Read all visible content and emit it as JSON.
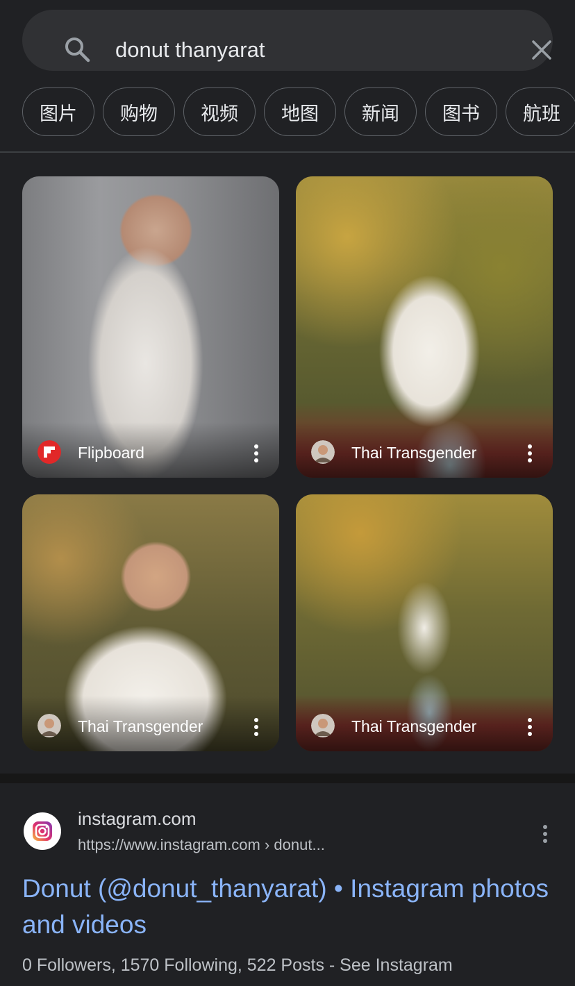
{
  "search": {
    "query": "donut thanyarat"
  },
  "chips": [
    {
      "label": "图片"
    },
    {
      "label": "购物"
    },
    {
      "label": "视频"
    },
    {
      "label": "地图"
    },
    {
      "label": "新闻"
    },
    {
      "label": "图书"
    },
    {
      "label": "航班"
    }
  ],
  "images": [
    {
      "source": "Flipboard",
      "source_icon": "flipboard-icon"
    },
    {
      "source": "Thai Transgender",
      "source_icon": "thai-transgender-avatar"
    },
    {
      "source": "Thai Transgender",
      "source_icon": "thai-transgender-avatar"
    },
    {
      "source": "Thai Transgender",
      "source_icon": "thai-transgender-avatar"
    }
  ],
  "result": {
    "site_name": "instagram.com",
    "url": "https://www.instagram.com › donut...",
    "title": "Donut (@donut_thanyarat) • Instagram photos and videos",
    "snippet": "0 Followers, 1570 Following, 522 Posts - See Instagram"
  },
  "colors": {
    "background": "#202124",
    "search_bg": "#303134",
    "link": "#8ab4f8",
    "flipboard_red": "#e12828"
  }
}
